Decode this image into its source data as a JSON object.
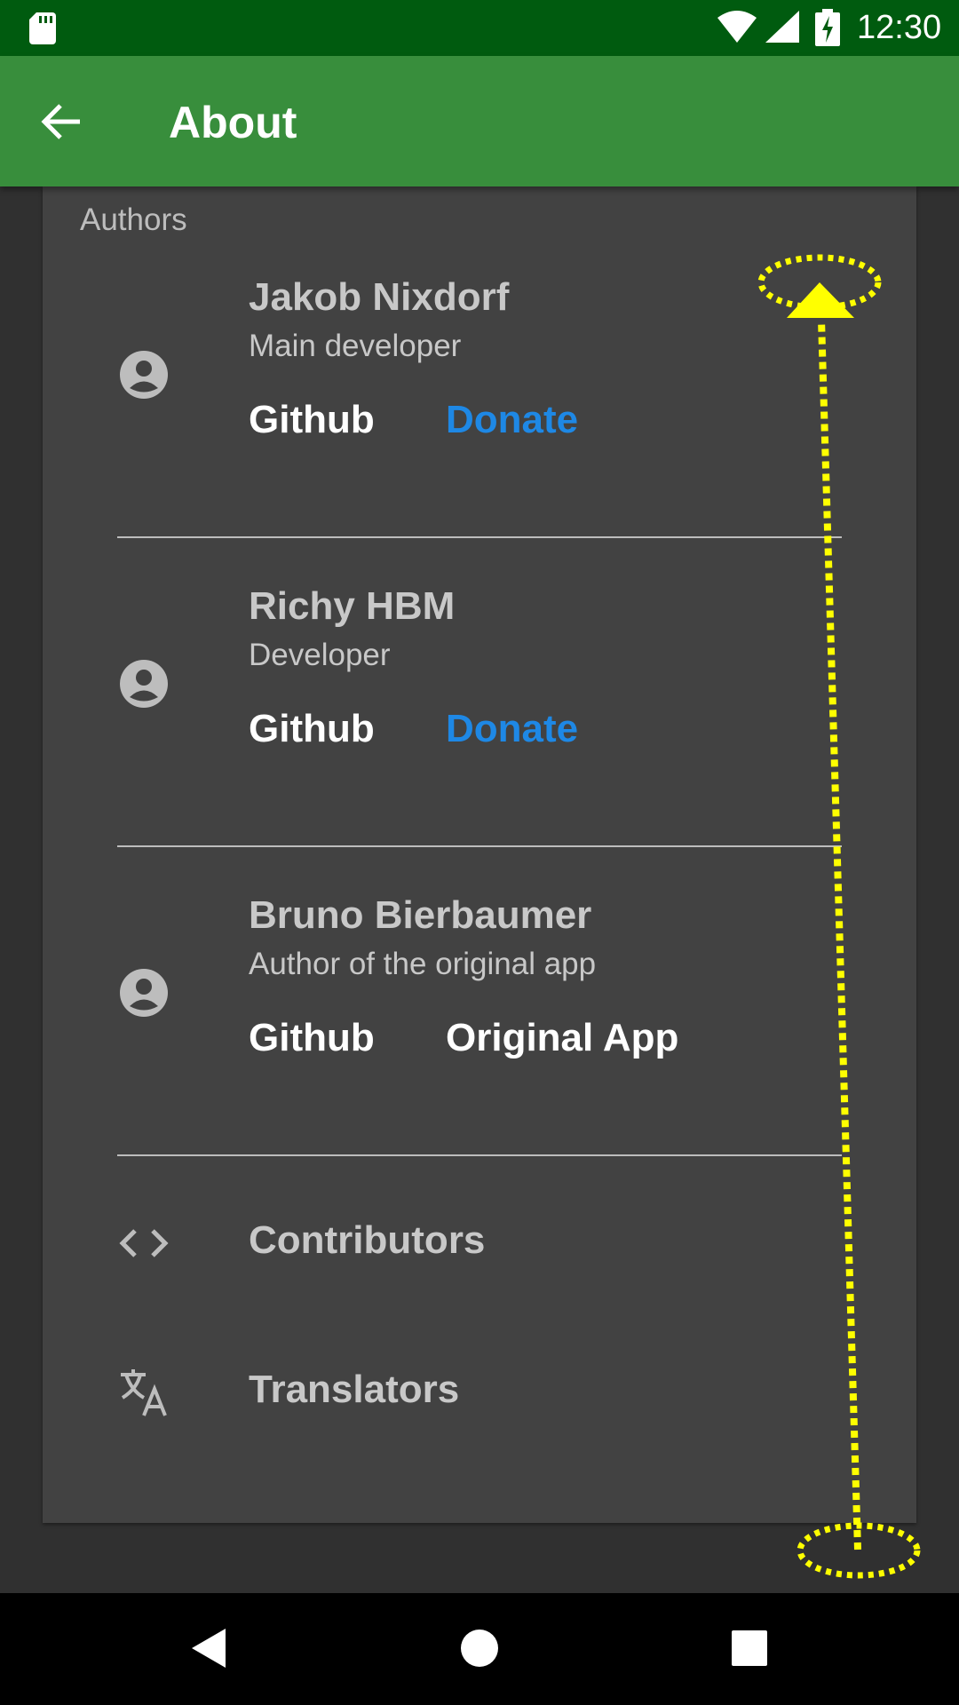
{
  "status_bar": {
    "time": "12:30",
    "icons": [
      "sd-card-icon",
      "wifi-icon",
      "signal-icon",
      "battery-charging-icon"
    ]
  },
  "app_bar": {
    "title": "About",
    "back_icon": "arrow-back-icon"
  },
  "section": {
    "label": "Authors"
  },
  "authors": [
    {
      "name": "Jakob Nixdorf",
      "role": "Main developer",
      "link1": "Github",
      "link2": "Donate",
      "link2_color": "#1e88e5"
    },
    {
      "name": "Richy HBM",
      "role": "Developer",
      "link1": "Github",
      "link2": "Donate",
      "link2_color": "#1e88e5"
    },
    {
      "name": "Bruno Bierbaumer",
      "role": "Author of the original app",
      "link1": "Github",
      "link2": "Original App",
      "link2_color": "#ffffff"
    }
  ],
  "rows": [
    {
      "label": "Contributors",
      "icon": "code-icon"
    },
    {
      "label": "Translators",
      "icon": "translate-icon"
    }
  ],
  "overlay": {
    "gesture": "swipe-up",
    "color": "#ffff00"
  },
  "nav_bar": {
    "buttons": [
      "back-triangle-icon",
      "home-circle-icon",
      "recents-square-icon"
    ]
  },
  "colors": {
    "app_bar": "#388e3c",
    "status_bar": "#005b0f",
    "card": "#424242",
    "accent": "#1e88e5"
  }
}
